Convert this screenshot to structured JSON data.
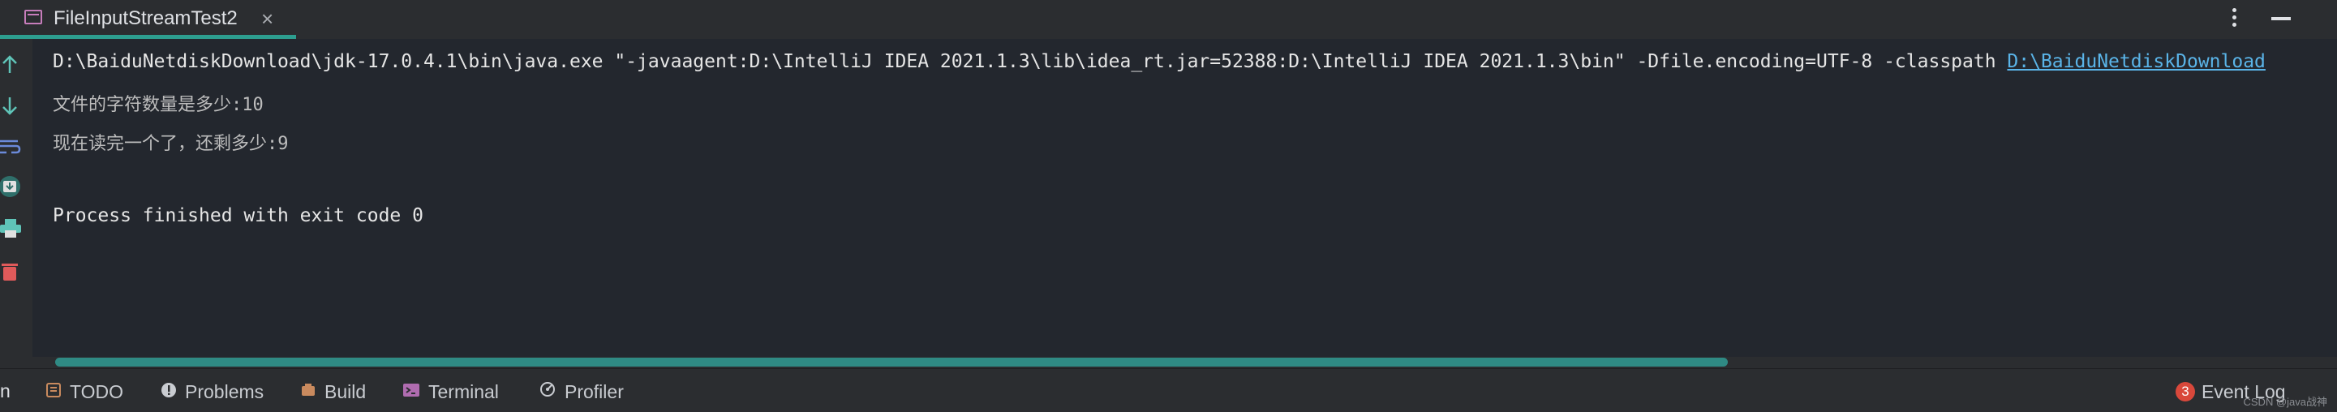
{
  "tab": {
    "title": "FileInputStreamTest2",
    "close_glyph": "×",
    "icon": "run-config-icon"
  },
  "header_actions": {
    "more_icon": "more-vertical-icon",
    "minimize_icon": "minimize-icon"
  },
  "gutter": {
    "icons": [
      "arrow-up-icon",
      "arrow-down-icon",
      "soft-wrap-icon",
      "scroll-to-end-icon",
      "print-icon",
      "trash-icon"
    ]
  },
  "console": {
    "command_prefix": "D:\\BaiduNetdiskDownload\\jdk-17.0.4.1\\bin\\java.exe \"-javaagent:D:\\IntelliJ IDEA 2021.1.3\\lib\\idea_rt.jar=52388:D:\\IntelliJ IDEA 2021.1.3\\bin\" -Dfile.encoding=UTF-8 -classpath ",
    "command_link": "D:\\BaiduNetdiskDownload",
    "output_line_1": "文件的字符数量是多少:10",
    "output_line_2": "现在读完一个了，还剩多少:9",
    "finish_line": "Process finished with exit code 0"
  },
  "bottom_bar": {
    "run_stub": "n",
    "todo": "TODO",
    "problems": "Problems",
    "build": "Build",
    "terminal": "Terminal",
    "profiler": "Profiler",
    "event_log": "Event Log",
    "event_count": "3"
  },
  "watermark": "CSDN @java战神",
  "colors": {
    "accent": "#2d9e8f",
    "link": "#5ab4e8",
    "badge": "#d9483b"
  }
}
